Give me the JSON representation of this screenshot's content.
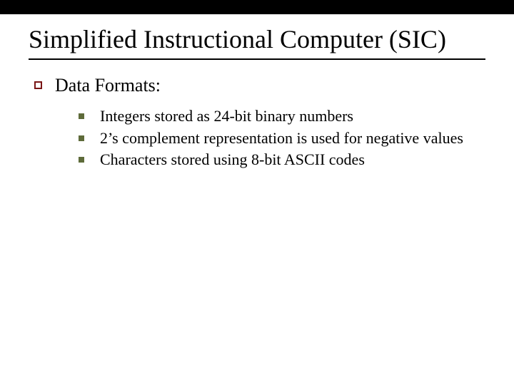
{
  "title": "Simplified Instructional Computer (SIC)",
  "section": {
    "heading": "Data Formats:",
    "items": [
      "Integers stored as 24-bit binary numbers",
      "2’s complement representation is used for negative values",
      "Characters stored using 8-bit ASCII codes"
    ]
  },
  "colors": {
    "outer_bullet": "#7a1616",
    "inner_bullet": "#5e6b3a"
  }
}
